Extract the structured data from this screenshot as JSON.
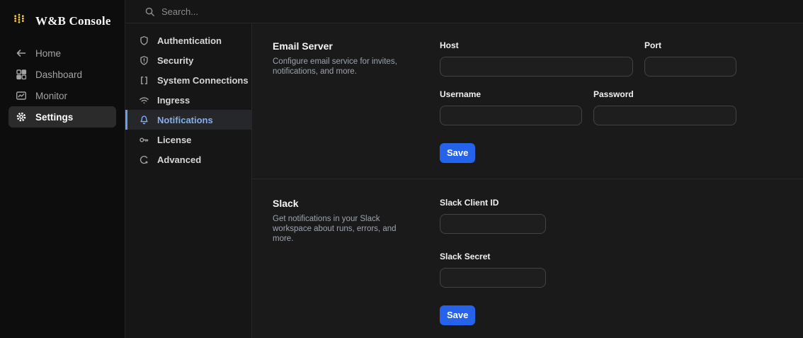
{
  "brand": {
    "title": "W&B Console",
    "logo_icon": "wandb-dots-logo",
    "logo_color": "#ffcc33"
  },
  "topbar": {
    "search_placeholder": "Search..."
  },
  "sidebar": {
    "items": [
      {
        "label": "Home",
        "icon": "arrow-left-icon",
        "active": false
      },
      {
        "label": "Dashboard",
        "icon": "dashboard-grid-icon",
        "active": false
      },
      {
        "label": "Monitor",
        "icon": "monitor-chart-icon",
        "active": false
      },
      {
        "label": "Settings",
        "icon": "gear-icon",
        "active": true
      }
    ]
  },
  "settings_nav": {
    "items": [
      {
        "label": "Authentication",
        "icon": "shield-icon",
        "active": false
      },
      {
        "label": "Security",
        "icon": "shield-alert-icon",
        "active": false
      },
      {
        "label": "System Connections",
        "icon": "brackets-icon",
        "active": false
      },
      {
        "label": "Ingress",
        "icon": "wifi-icon",
        "active": false
      },
      {
        "label": "Notifications",
        "icon": "bell-icon",
        "active": true
      },
      {
        "label": "License",
        "icon": "key-icon",
        "active": false
      },
      {
        "label": "Advanced",
        "icon": "dial-icon",
        "active": false
      }
    ]
  },
  "sections": [
    {
      "title": "Email Server",
      "description": "Configure email service for invites, notifications, and more.",
      "fields": [
        {
          "label": "Host",
          "value": ""
        },
        {
          "label": "Port",
          "value": ""
        },
        {
          "label": "Username",
          "value": ""
        },
        {
          "label": "Password",
          "value": ""
        }
      ],
      "save_label": "Save"
    },
    {
      "title": "Slack",
      "description": "Get notifications in your Slack workspace about runs, errors, and more.",
      "fields": [
        {
          "label": "Slack Client ID",
          "value": ""
        },
        {
          "label": "Slack Secret",
          "value": ""
        }
      ],
      "save_label": "Save"
    }
  ],
  "colors": {
    "accent_blue": "#2563eb",
    "nav_active_blue": "#82aef2",
    "nav_active_bar": "#6d9eeb",
    "brand_yellow": "#ffcc33",
    "left_sidebar_bg": "#0d0d0d",
    "panel_bg": "#161616",
    "main_bg": "#1a1a1a"
  }
}
